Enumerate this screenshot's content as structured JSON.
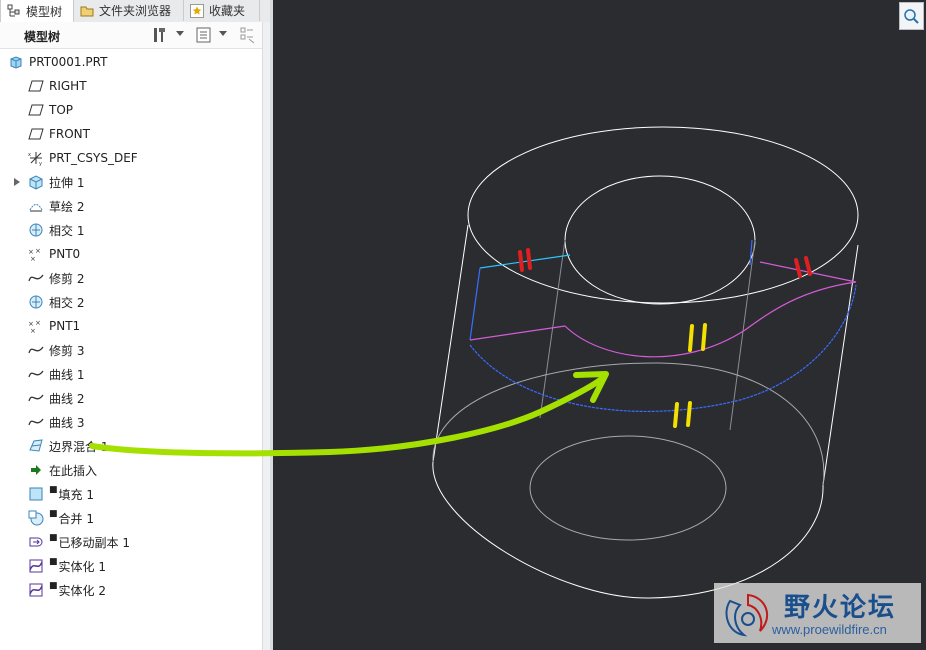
{
  "tabs": [
    {
      "label": "模型树",
      "active": true
    },
    {
      "label": "文件夹浏览器",
      "active": false
    },
    {
      "label": "收藏夹",
      "active": false
    }
  ],
  "toolbar": {
    "title": "模型树"
  },
  "tree": {
    "root": "PRT0001.PRT",
    "items": [
      {
        "label": "RIGHT",
        "icon": "datum-plane-icon"
      },
      {
        "label": "TOP",
        "icon": "datum-plane-icon"
      },
      {
        "label": "FRONT",
        "icon": "datum-plane-icon"
      },
      {
        "label": "PRT_CSYS_DEF",
        "icon": "coordinate-system-icon"
      },
      {
        "label": "拉伸 1",
        "icon": "extrude-icon",
        "expandable": true
      },
      {
        "label": "草绘 2",
        "icon": "sketch-icon"
      },
      {
        "label": "相交 1",
        "icon": "intersect-icon"
      },
      {
        "label": "PNT0",
        "icon": "datum-point-icon"
      },
      {
        "label": "修剪 2",
        "icon": "curve-icon"
      },
      {
        "label": "相交 2",
        "icon": "intersect-icon"
      },
      {
        "label": "PNT1",
        "icon": "datum-point-icon"
      },
      {
        "label": "修剪 3",
        "icon": "curve-icon"
      },
      {
        "label": "曲线 1",
        "icon": "curve-icon"
      },
      {
        "label": "曲线 2",
        "icon": "curve-icon"
      },
      {
        "label": "曲线 3",
        "icon": "curve-icon"
      },
      {
        "label": "边界混合 1",
        "icon": "boundary-blend-icon"
      },
      {
        "label": "在此插入",
        "icon": "insert-here-arrow-icon"
      },
      {
        "label": "填充 1",
        "icon": "fill-icon",
        "marked": true
      },
      {
        "label": "合并 1",
        "icon": "merge-icon",
        "marked": true
      },
      {
        "label": "已移动副本 1",
        "icon": "moved-copy-icon",
        "marked": true
      },
      {
        "label": "实体化 1",
        "icon": "solidify-icon",
        "marked": true
      },
      {
        "label": "实体化 2",
        "icon": "solidify-icon",
        "marked": true
      }
    ]
  },
  "colors": {
    "viewport_bg": "#2a2c30",
    "edge_white": "#ffffff",
    "edge_cyan": "#2ec7ff",
    "edge_blue": "#3b6cff",
    "edge_magenta": "#d45cd8",
    "annotation_green": "#a4e000",
    "mark_red": "#e02020",
    "mark_yellow": "#f4e000"
  },
  "watermark": {
    "title": "野火论坛",
    "url": "www.proewildfire.cn"
  }
}
